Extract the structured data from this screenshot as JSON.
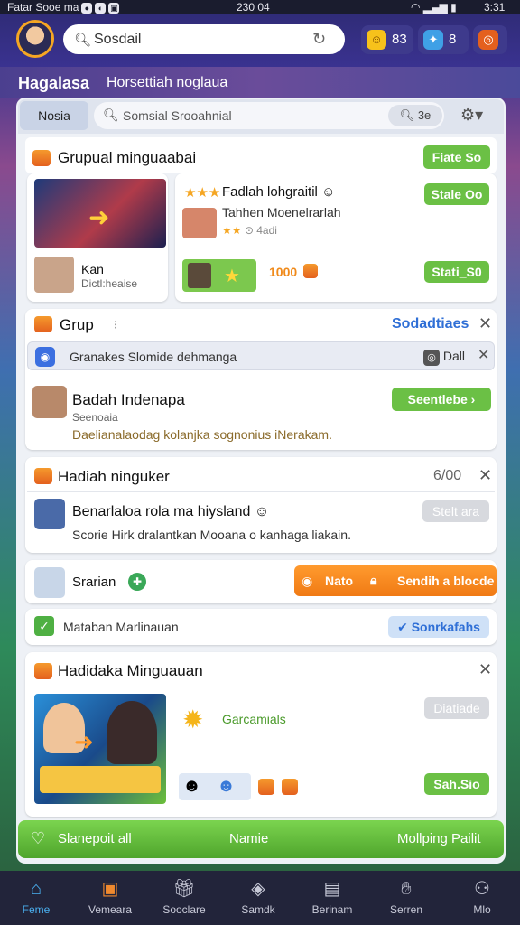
{
  "status": {
    "left": "Fatar Sooe ma",
    "center": "230 04",
    "right": "3:31"
  },
  "topbar": {
    "search_text": "Sosdail",
    "coins": [
      {
        "value": "83"
      },
      {
        "value": "8"
      },
      {
        "value": ""
      }
    ]
  },
  "title_strip": {
    "title": "Hagalasa",
    "subtitle": "Horsettiah noglaua"
  },
  "tabs": {
    "active": "Nosia",
    "search_placeholder": "Somsial Srooahnial",
    "search_button": "3e"
  },
  "section1": {
    "title": "Grupual minguaabai",
    "button": "Fiate So",
    "card_a": {
      "name": "Kan",
      "sub": "Dictl:heaise"
    },
    "card_b": {
      "title": "Fadlah lohgraitil",
      "sub": "Tahhen Moenelrarlah",
      "rating": "4adi",
      "button_top": "Stale Oo",
      "points": "1000",
      "button_bottom": "Stati_S0"
    }
  },
  "section2": {
    "title": "Grup",
    "link": "Sodadtiaes",
    "notice": "Granakes Slomide dehmanga",
    "notice_btn": "Dall",
    "item": {
      "title": "Badah Indenapa",
      "sub": "Seenoaia",
      "desc": "Daelianalaodag kolanjka sognonius iNerakam.",
      "button": "Seentlebe"
    }
  },
  "section3": {
    "title": "Hadiah ninguker",
    "count": "6/00",
    "item_title": "Benarlaloa rola ma hiysland",
    "item_desc": "Scorie Hirk dralantkan Mooana o kanhaga liakain.",
    "button": "Stelt ara"
  },
  "row4": {
    "label": "Srarian",
    "orange_left": "Nato",
    "orange_right": "Sendih a blocde"
  },
  "row5": {
    "label": "Mataban Marlinauan",
    "button": "Sonrkafahs"
  },
  "section6": {
    "title": "Hadidaka Minguauan",
    "label": "Garcamials",
    "button_top": "Diatiade",
    "button_bottom": "Sah.Sio"
  },
  "greenbar": {
    "left": "Slanepoit all",
    "center": "Namie",
    "right": "Mollping Pailit"
  },
  "nav": [
    {
      "label": "Feme",
      "icon": "home-icon"
    },
    {
      "label": "Vemeara",
      "icon": "box-icon"
    },
    {
      "label": "Sooclare",
      "icon": "gift-icon"
    },
    {
      "label": "Samdk",
      "icon": "cube-icon"
    },
    {
      "label": "Berinam",
      "icon": "present-icon"
    },
    {
      "label": "Serren",
      "icon": "handshake-icon"
    },
    {
      "label": "Mlo",
      "icon": "people-icon"
    }
  ],
  "colors": {
    "accent_green": "#6bc045",
    "accent_orange": "#f5a623",
    "nav_bg": "#22243a",
    "link_blue": "#2f6fd6"
  }
}
